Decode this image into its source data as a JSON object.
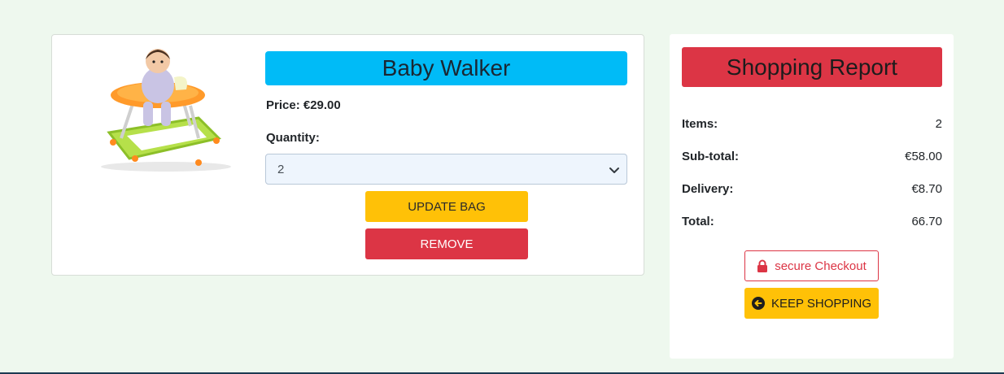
{
  "product": {
    "image_alt": "Baby walker product photo",
    "title": "Baby Walker",
    "price": "Price: €29.00",
    "quantity_label": "Quantity:",
    "quantity_value": "2",
    "update_label": "UPDATE BAG",
    "remove_label": "REMOVE"
  },
  "report": {
    "title": "Shopping Report",
    "rows": [
      {
        "label": "Items:",
        "value": "2"
      },
      {
        "label": "Sub-total:",
        "value": "€58.00"
      },
      {
        "label": "Delivery:",
        "value": "€8.70"
      },
      {
        "label": "Total:",
        "value": "66.70"
      }
    ],
    "checkout_label": "secure Checkout",
    "keep_shopping_label": "KEEP SHOPPING"
  },
  "colors": {
    "info": "#00bbf7",
    "warning": "#ffc107",
    "danger": "#dc3545",
    "page_bg": "#eef8ee"
  },
  "icons": {
    "checkout": "lock-icon",
    "keep_shopping": "arrow-circle-left-icon",
    "select": "chevron-down-icon"
  }
}
